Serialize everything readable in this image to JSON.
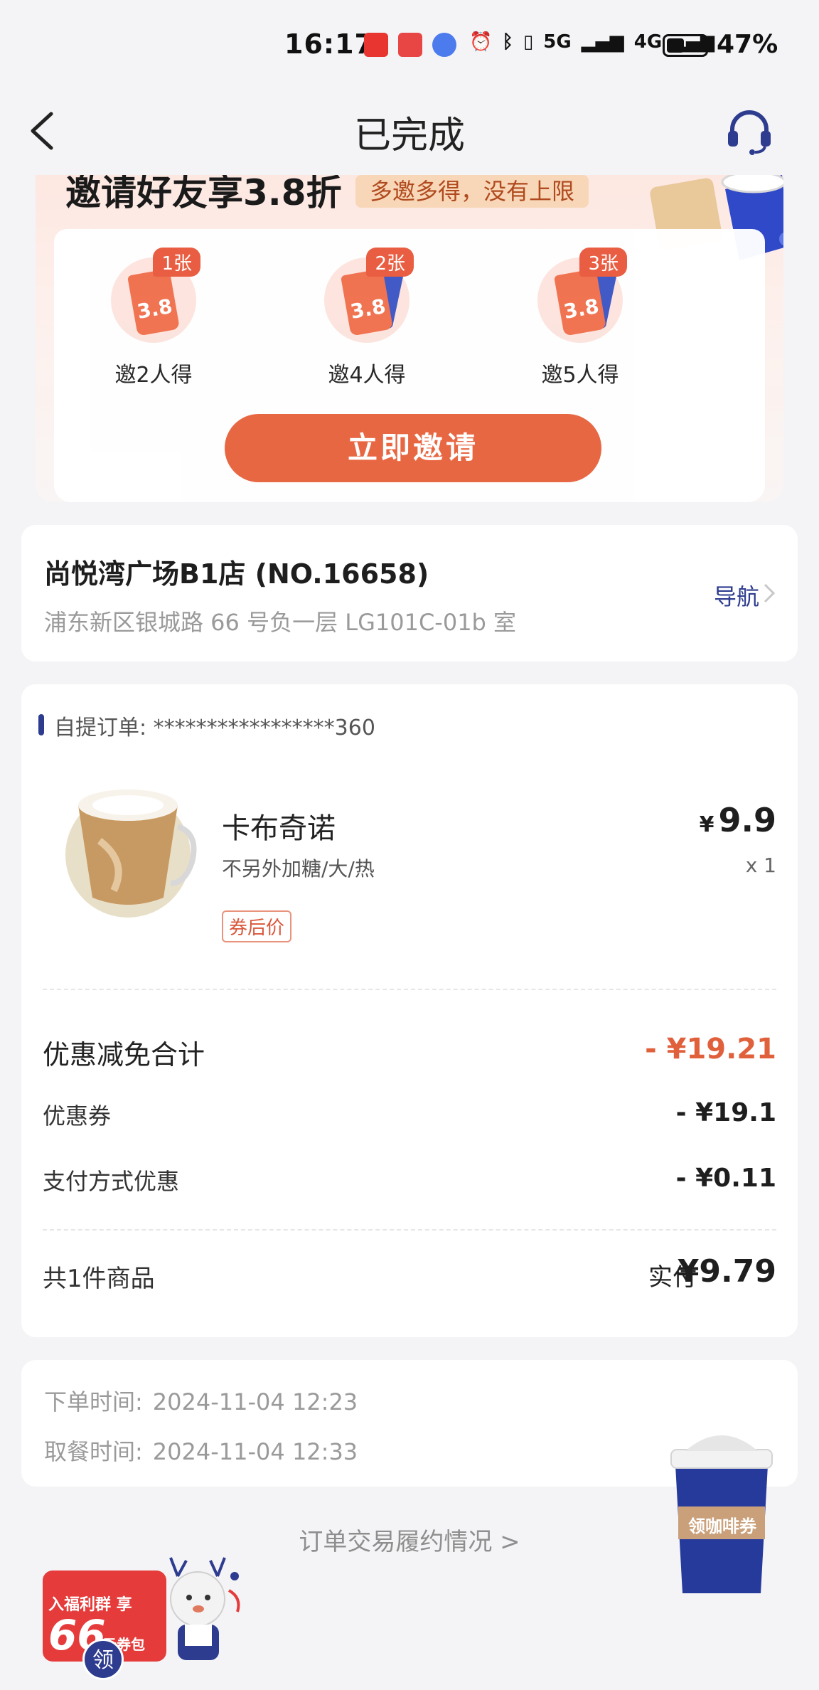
{
  "status_bar": {
    "time": "16:17",
    "network_icons": [
      "5G",
      "4G"
    ],
    "battery_percent": "47%",
    "battery_level": 0.47,
    "colors": {
      "app1": "#e8352f",
      "app2": "#e84545",
      "app3": "#4b7bec"
    }
  },
  "nav": {
    "title": "已完成",
    "back_icon": "chevron-left-icon",
    "service_icon": "headset-icon"
  },
  "invite": {
    "title": "邀请好友享3.8折",
    "tag": "多邀多得，没有上限",
    "tiers": [
      {
        "badge": "1张",
        "label": "邀2人得",
        "ticket_value": "3.8"
      },
      {
        "badge": "2张",
        "label": "邀4人得",
        "ticket_value": "3.8"
      },
      {
        "badge": "3张",
        "label": "邀5人得",
        "ticket_value": "3.8"
      }
    ],
    "button": "立即邀请"
  },
  "store": {
    "name": "尚悦湾广场B1店 (NO.16658)",
    "address": "浦东新区银城路 66 号负一层 LG101C-01b 室",
    "nav_label": "导航"
  },
  "order": {
    "order_no_label": "自提订单: *****************360",
    "product": {
      "name": "卡布奇诺",
      "spec": "不另外加糖/大/热",
      "tag": "券后价",
      "currency": "¥",
      "price": "9.9",
      "qty": "x 1"
    },
    "discount_total_label": "优惠减免合计",
    "discount_total_value": "- ¥19.21",
    "coupon_label": "优惠券",
    "coupon_value": "- ¥19.1",
    "payment_discount_label": "支付方式优惠",
    "payment_discount_value": "- ¥0.11",
    "item_count_label": "共1件商品",
    "paid_label": "实付",
    "paid_value": "¥9.79"
  },
  "times": {
    "order_time_label": "下单时间:",
    "order_time": "2024-11-04 12:23",
    "pickup_time_label": "取餐时间:",
    "pickup_time": "2024-11-04 12:33"
  },
  "footer": {
    "fulfilment_link": "订单交易履约情况 >"
  },
  "widgets": {
    "coffee_coupon": "领咖啡券",
    "group_line1": "入福利群 享",
    "group_amount": "66",
    "group_unit": "元券包",
    "group_claim": "领"
  }
}
